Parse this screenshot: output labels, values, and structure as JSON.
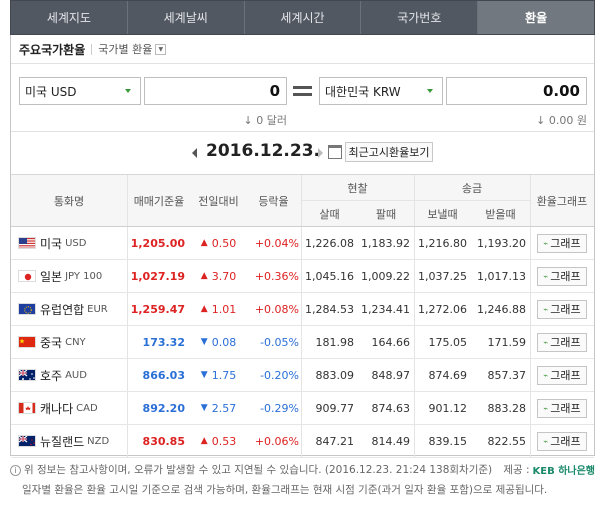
{
  "tabs": [
    {
      "label": "세계지도",
      "active": false
    },
    {
      "label": "세계날씨",
      "active": false
    },
    {
      "label": "세계시간",
      "active": false
    },
    {
      "label": "국가번호",
      "active": false
    },
    {
      "label": "환율",
      "active": true
    }
  ],
  "subheader": {
    "title": "주요국가환율",
    "link": "국가별 환율"
  },
  "converter": {
    "from_currency": "미국 USD",
    "from_amount": "0",
    "from_hint": "0 달러",
    "to_currency": "대한민국 KRW",
    "to_amount": "0.00",
    "to_hint": "0.00 원"
  },
  "date": {
    "value": "2016.12.23.",
    "recent_button": "최근고시환율보기"
  },
  "table": {
    "headers": {
      "currency": "통화명",
      "base_rate": "매매기준율",
      "change": "전일대비",
      "rate_change": "등락율",
      "cash": "현찰",
      "cash_buy": "살때",
      "cash_sell": "팔때",
      "remit": "송금",
      "remit_send": "보낼때",
      "remit_recv": "받을때",
      "graph": "환율그래프"
    },
    "graph_label": "그래프",
    "rows": [
      {
        "flag": "us",
        "name": "미국",
        "code": "USD",
        "base": "1,205.00",
        "dir": "up",
        "change": "0.50",
        "pct": "+0.04%",
        "cash_buy": "1,226.08",
        "cash_sell": "1,183.92",
        "send": "1,216.80",
        "recv": "1,193.20"
      },
      {
        "flag": "jp",
        "name": "일본",
        "code": "JPY 100",
        "base": "1,027.19",
        "dir": "up",
        "change": "3.70",
        "pct": "+0.36%",
        "cash_buy": "1,045.16",
        "cash_sell": "1,009.22",
        "send": "1,037.25",
        "recv": "1,017.13"
      },
      {
        "flag": "eu",
        "name": "유럽연합",
        "code": "EUR",
        "base": "1,259.47",
        "dir": "up",
        "change": "1.01",
        "pct": "+0.08%",
        "cash_buy": "1,284.53",
        "cash_sell": "1,234.41",
        "send": "1,272.06",
        "recv": "1,246.88"
      },
      {
        "flag": "cn",
        "name": "중국",
        "code": "CNY",
        "base": "173.32",
        "dir": "down",
        "change": "0.08",
        "pct": "-0.05%",
        "cash_buy": "181.98",
        "cash_sell": "164.66",
        "send": "175.05",
        "recv": "171.59"
      },
      {
        "flag": "au",
        "name": "호주",
        "code": "AUD",
        "base": "866.03",
        "dir": "down",
        "change": "1.75",
        "pct": "-0.20%",
        "cash_buy": "883.09",
        "cash_sell": "848.97",
        "send": "874.69",
        "recv": "857.37"
      },
      {
        "flag": "ca",
        "name": "캐나다",
        "code": "CAD",
        "base": "892.20",
        "dir": "down",
        "change": "2.57",
        "pct": "-0.29%",
        "cash_buy": "909.77",
        "cash_sell": "874.63",
        "send": "901.12",
        "recv": "883.28"
      },
      {
        "flag": "nz",
        "name": "뉴질랜드",
        "code": "NZD",
        "base": "830.85",
        "dir": "up",
        "change": "0.53",
        "pct": "+0.06%",
        "cash_buy": "847.21",
        "cash_sell": "814.49",
        "send": "839.15",
        "recv": "822.55"
      }
    ]
  },
  "footer": {
    "line1": "위 정보는 참고사항이며, 오류가 발생할 수 있고 지연될 수 있습니다. (2016.12.23. 21:24 138회차기준)",
    "source_label": "제공 :",
    "source_name": "KEB 하나은행",
    "line2": "일자별 환율은 환율 고시일 기준으로 검색 가능하며, 환율그래프는 현재 시점 기준(과거 일자 환율 포함)으로 제공됩니다."
  },
  "colors": {
    "up": "#dd2222",
    "down": "#2a6fd6",
    "tab_bg": "#525861",
    "tab_active": "#72787f"
  }
}
